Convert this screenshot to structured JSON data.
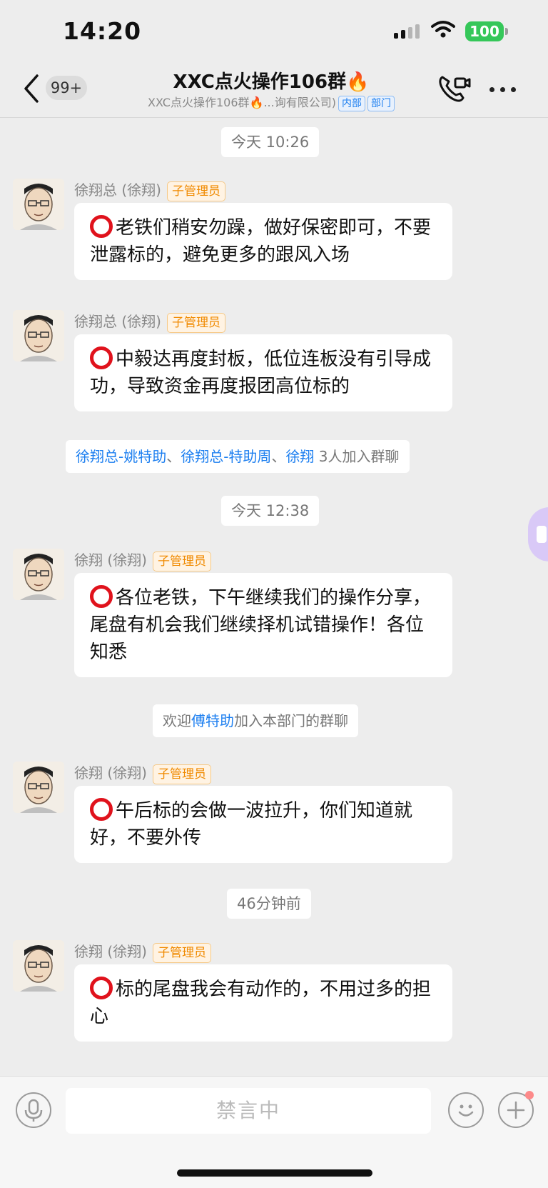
{
  "status": {
    "time": "14:20",
    "battery": "100"
  },
  "header": {
    "unread_count": "99+",
    "title": "XXC点火操作106群",
    "subtitle": "XXC点火操作106群",
    "subtitle_suffix": "...询有限公司)",
    "tag_internal": "内部",
    "tag_department": "部门"
  },
  "timestamps": [
    "今天 10:26",
    "今天 12:38",
    "46分钟前"
  ],
  "join_note": {
    "names": [
      "徐翔总-姚特助",
      "徐翔总-特助周",
      "徐翔"
    ],
    "separator": "、",
    "suffix": " 3人加入群聊"
  },
  "welcome_note": {
    "prefix": "欢迎",
    "name": "傅特助",
    "suffix": "加入本部门的群聊"
  },
  "role_badge": "子管理员",
  "messages": [
    {
      "sender": "徐翔总 (徐翔)",
      "text": "老铁们稍安勿躁，做好保密即可，不要泄露标的，避免更多的跟风入场"
    },
    {
      "sender": "徐翔总 (徐翔)",
      "text": "中毅达再度封板，低位连板没有引导成功，导致资金再度报团高位标的"
    },
    {
      "sender": "徐翔 (徐翔)",
      "text": "各位老铁，下午继续我们的操作分享，尾盘有机会我们继续择机试错操作！各位知悉"
    },
    {
      "sender": "徐翔 (徐翔)",
      "text": "午后标的会做一波拉升，你们知道就好，不要外传"
    },
    {
      "sender": "徐翔 (徐翔)",
      "text": "标的尾盘我会有动作的，不用过多的担心"
    }
  ],
  "input": {
    "muted_label": "禁言中"
  }
}
